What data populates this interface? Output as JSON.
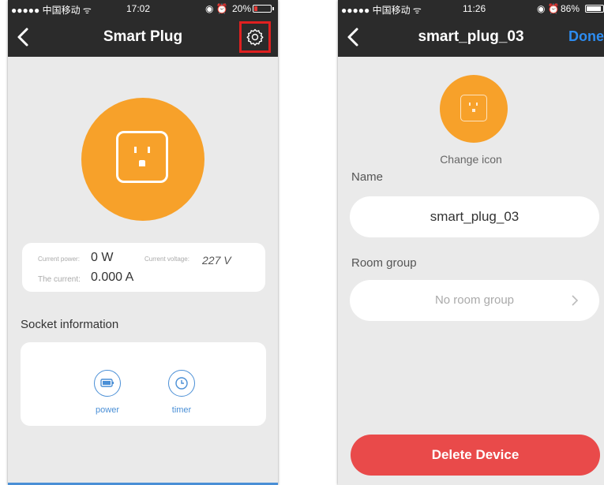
{
  "left": {
    "status": {
      "carrier": "●●●●● 中国移动 ᯤ",
      "time": "17:02",
      "battery": "20%"
    },
    "nav": {
      "title": "Smart Plug"
    },
    "readings": {
      "power_label": "Current power:",
      "power_value": "0 W",
      "voltage_label": "Current voltage:",
      "voltage_value": "227 V",
      "current_label": "The current:",
      "current_value": "0.000 A"
    },
    "socket_info_title": "Socket information",
    "buttons": {
      "power": "power",
      "timer": "timer"
    }
  },
  "right": {
    "status": {
      "carrier": "●●●●● 中国移动 ᯤ",
      "time": "11:26",
      "battery": "86%"
    },
    "nav": {
      "title": "smart_plug_03",
      "done": "Done"
    },
    "change_icon": "Change icon",
    "name_label": "Name",
    "name_value": "smart_plug_03",
    "room_label": "Room group",
    "room_value": "No room group",
    "delete": "Delete Device"
  },
  "colors": {
    "accent_orange": "#f7a12a",
    "nav_bg": "#2b2b2b",
    "link_blue": "#2d8cf0",
    "delete_red": "#e94a4a",
    "highlight_red": "#e02020"
  }
}
